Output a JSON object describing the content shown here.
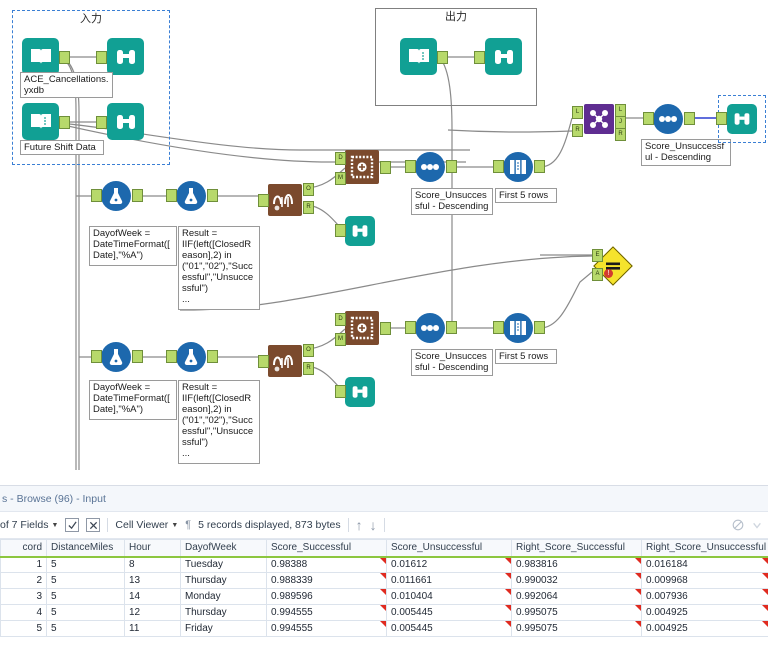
{
  "canvas": {
    "containers": [
      {
        "name": "input-container",
        "title": "入力"
      },
      {
        "name": "output-container",
        "title": "出力"
      }
    ],
    "annotations": {
      "input_file": "ACE_Cancellations.yxdb",
      "future_shift": "Future Shift Data",
      "formula_dayofweek": "DayofWeek = DateTimeFormat([Date],\"%A\")",
      "formula_result": "Result = IIF(left([ClosedReason],2) in (\"01\",\"02\"),\"Successful\",\"Unsuccessful\")\n...",
      "sort_label": "Score_Unsuccessful - Descending",
      "sample_label": "First 5 rows",
      "sort_label_right": "Score_Unsuccessful - Descending"
    },
    "tool_names": {
      "input": "input-data-tool",
      "browse": "browse-tool",
      "formula": "formula-tool",
      "score": "score-tool",
      "sort": "sort-tool",
      "sample": "sample-tool",
      "join": "join-tool",
      "test": "test-tool"
    },
    "ports": {
      "score_in_data": "D",
      "score_in_model": "M",
      "predict_out_o": "O",
      "predict_out_r": "R",
      "join_in_left": "L",
      "join_in_right": "R",
      "join_out_left": "L",
      "join_out_join": "J",
      "join_out_right": "R",
      "test_in_e": "E",
      "test_in_a": "A"
    },
    "colors": {
      "teal": "#11a094",
      "blue": "#1d68ad",
      "brown": "#7b4a2d",
      "purple": "#5f2d91",
      "yellow": "#f5e32c",
      "port_green": "#b7d96b",
      "selection": "#3b7fd4"
    }
  },
  "results": {
    "title": "s - Browse (96) - Input",
    "toolbar": {
      "fields_label": "of 7 Fields",
      "viewer_label": "Cell Viewer",
      "records_label": "5 records displayed, 873 bytes",
      "check_icon": "check-box-icon",
      "cancel_icon": "cancel-box-icon",
      "paragraph_icon": "pilcrow-icon",
      "up_icon": "arrow-up-icon",
      "down_icon": "arrow-down-icon",
      "block_icon": "no-entry-icon",
      "caret_icon": "chevron-down-icon"
    },
    "table": {
      "columns": [
        "cord",
        "DistanceMiles",
        "Hour",
        "DayofWeek",
        "Score_Successful",
        "Score_Unsuccessful",
        "Right_Score_Successful",
        "Right_Score_Unsuccessful"
      ],
      "rows": [
        {
          "record": "1",
          "DistanceMiles": "5",
          "Hour": "8",
          "DayofWeek": "Tuesday",
          "Score_Successful": "0.98388",
          "Score_Unsuccessful": "0.01612",
          "Right_Score_Successful": "0.983816",
          "Right_Score_Unsuccessful": "0.016184"
        },
        {
          "record": "2",
          "DistanceMiles": "5",
          "Hour": "13",
          "DayofWeek": "Thursday",
          "Score_Successful": "0.988339",
          "Score_Unsuccessful": "0.011661",
          "Right_Score_Successful": "0.990032",
          "Right_Score_Unsuccessful": "0.009968"
        },
        {
          "record": "3",
          "DistanceMiles": "5",
          "Hour": "14",
          "DayofWeek": "Monday",
          "Score_Successful": "0.989596",
          "Score_Unsuccessful": "0.010404",
          "Right_Score_Successful": "0.992064",
          "Right_Score_Unsuccessful": "0.007936"
        },
        {
          "record": "4",
          "DistanceMiles": "5",
          "Hour": "12",
          "DayofWeek": "Thursday",
          "Score_Successful": "0.994555",
          "Score_Unsuccessful": "0.005445",
          "Right_Score_Successful": "0.995075",
          "Right_Score_Unsuccessful": "0.004925"
        },
        {
          "record": "5",
          "DistanceMiles": "5",
          "Hour": "11",
          "DayofWeek": "Friday",
          "Score_Successful": "0.994555",
          "Score_Unsuccessful": "0.005445",
          "Right_Score_Successful": "0.995075",
          "Right_Score_Unsuccessful": "0.004925"
        }
      ]
    }
  }
}
